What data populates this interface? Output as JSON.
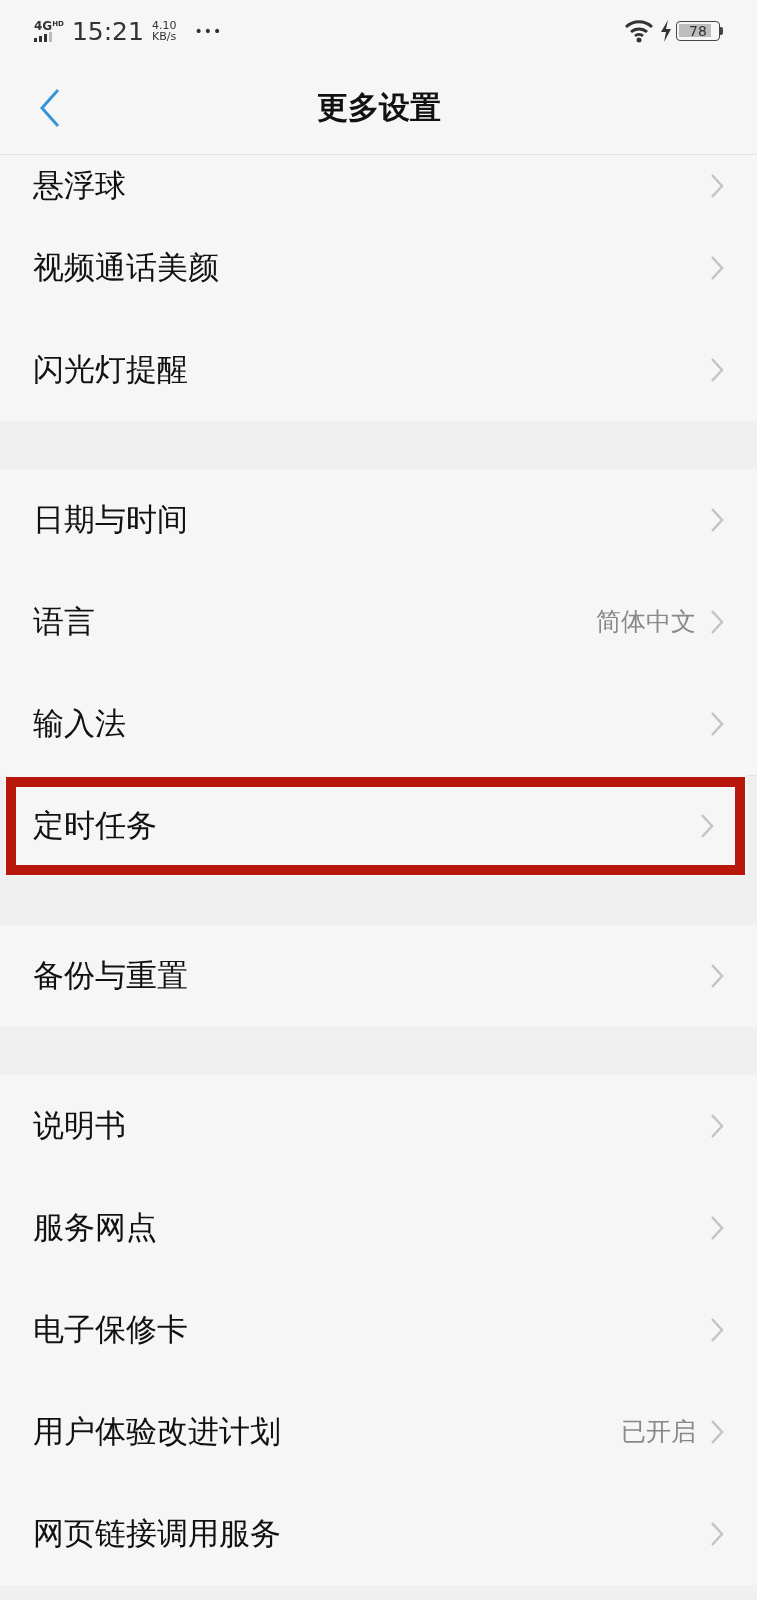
{
  "status_bar": {
    "network": "4G",
    "network_badge": "HD",
    "time": "15:21",
    "speed": "4.10",
    "speed_unit": "KB/s",
    "more": "•••",
    "battery": "78"
  },
  "nav": {
    "title": "更多设置"
  },
  "groups": [
    {
      "items": [
        {
          "label": "悬浮球",
          "highlighted": false
        },
        {
          "label": "视频通话美颜",
          "highlighted": false
        },
        {
          "label": "闪光灯提醒",
          "highlighted": false
        }
      ]
    },
    {
      "items": [
        {
          "label": "日期与时间",
          "highlighted": false
        },
        {
          "label": "语言",
          "value": "简体中文",
          "highlighted": false
        },
        {
          "label": "输入法",
          "highlighted": false
        },
        {
          "label": "定时任务",
          "highlighted": true
        }
      ]
    },
    {
      "items": [
        {
          "label": "备份与重置",
          "highlighted": false
        }
      ]
    },
    {
      "items": [
        {
          "label": "说明书",
          "highlighted": false
        },
        {
          "label": "服务网点",
          "highlighted": false
        },
        {
          "label": "电子保修卡",
          "highlighted": false
        },
        {
          "label": "用户体验改进计划",
          "value": "已开启",
          "highlighted": false
        },
        {
          "label": "网页链接调用服务",
          "highlighted": false
        }
      ]
    }
  ]
}
